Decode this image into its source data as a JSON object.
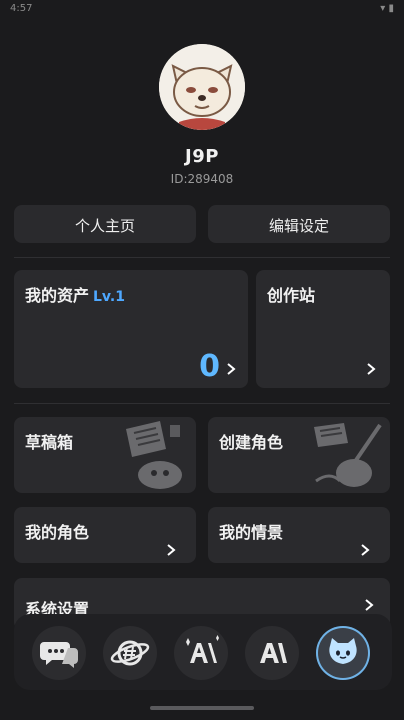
{
  "status": {
    "time": "4:57",
    "icons": "▾ ▮"
  },
  "profile": {
    "name": "J9P",
    "id": "ID:289408"
  },
  "actions": {
    "home_label": "个人主页",
    "edit_label": "编辑设定"
  },
  "assets": {
    "title": "我的资产",
    "level": "Lv.1",
    "value": "0"
  },
  "studio": {
    "title": "创作站"
  },
  "drafts": {
    "title": "草稿箱"
  },
  "create_role": {
    "title": "创建角色"
  },
  "my_roles": {
    "title": "我的角色"
  },
  "my_scenes": {
    "title": "我的情景"
  },
  "settings": {
    "title": "系统设置"
  },
  "dock": {
    "items": [
      "chat-icon",
      "planet-icon",
      "ai-sparkle-icon",
      "ai-icon",
      "cat-mascot-icon"
    ],
    "active_index": 4
  },
  "colors": {
    "accent": "#4ea8ff",
    "bg": "#1b1b1d",
    "card": "#2a2a2d"
  }
}
